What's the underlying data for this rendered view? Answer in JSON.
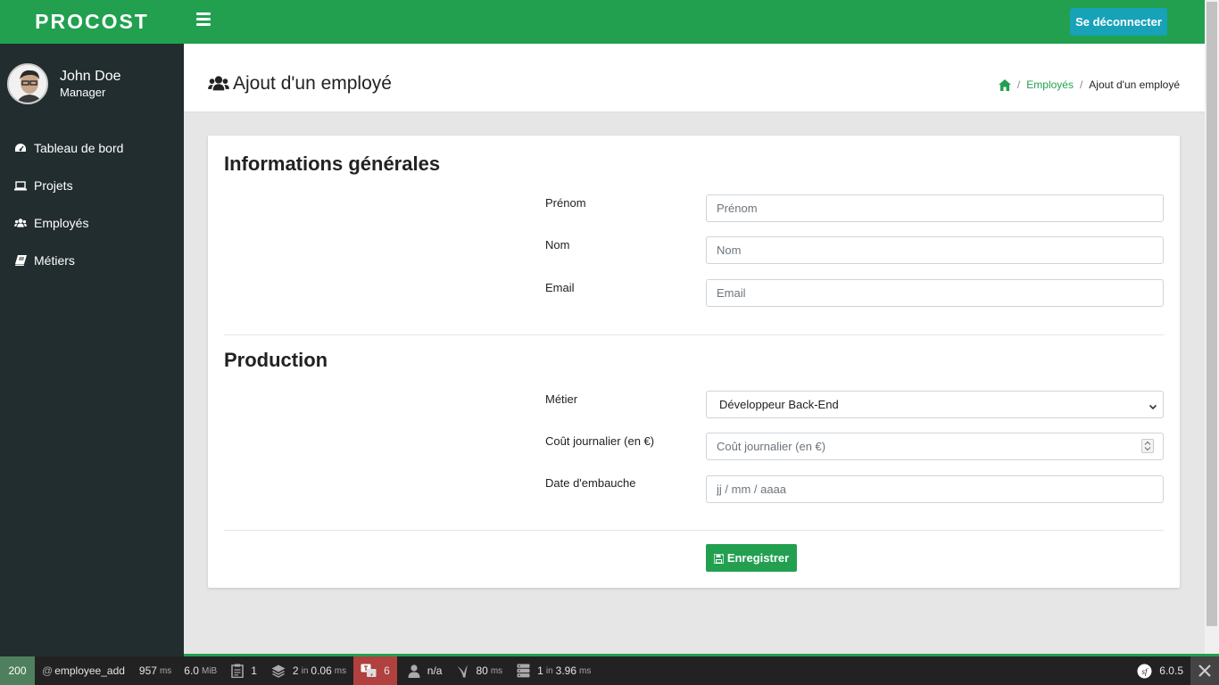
{
  "brand": "PROCOST",
  "user": {
    "name": "John Doe",
    "role": "Manager"
  },
  "sidebar": {
    "items": [
      {
        "label": "Tableau de bord",
        "icon": "dashboard-icon"
      },
      {
        "label": "Projets",
        "icon": "laptop-icon"
      },
      {
        "label": "Employés",
        "icon": "users-icon"
      },
      {
        "label": "Métiers",
        "icon": "book-icon"
      }
    ]
  },
  "topbar": {
    "logout_label": "Se déconnecter"
  },
  "header": {
    "title": "Ajout d'un employé",
    "breadcrumb": {
      "link": "Employés",
      "current": "Ajout d'un employé"
    }
  },
  "form": {
    "general": {
      "title": "Informations générales",
      "firstname": {
        "label": "Prénom",
        "placeholder": "Prénom"
      },
      "lastname": {
        "label": "Nom",
        "placeholder": "Nom"
      },
      "email": {
        "label": "Email",
        "placeholder": "Email"
      }
    },
    "production": {
      "title": "Production",
      "job": {
        "label": "Métier",
        "value": "Développeur Back-End"
      },
      "daily_cost": {
        "label": "Coût journalier (en €)",
        "placeholder": "Coût journalier (en €)"
      },
      "hire_date": {
        "label": "Date d'embauche",
        "placeholder": "jj / mm / aaaa"
      }
    },
    "save_label": "Enregistrer"
  },
  "debug": {
    "status": "200",
    "route": "employee_add",
    "time": "957",
    "time_unit": "ms",
    "memory": "6.0",
    "memory_unit": "MiB",
    "logs": "1",
    "cache_count": "2",
    "cache_in": "in",
    "cache_time": "0.06",
    "cache_unit": "ms",
    "translations": "6",
    "user": "n/a",
    "twig": "80",
    "twig_unit": "ms",
    "db_count": "1",
    "db_in": "in",
    "db_time": "3.96",
    "db_unit": "ms",
    "version": "6.0.5"
  },
  "colors": {
    "brand_green": "#22a050",
    "sidebar_dark": "#222d2f",
    "logout_blue": "#17a2b8",
    "debug_red": "#b0413e",
    "debug_green": "#4f805d"
  }
}
